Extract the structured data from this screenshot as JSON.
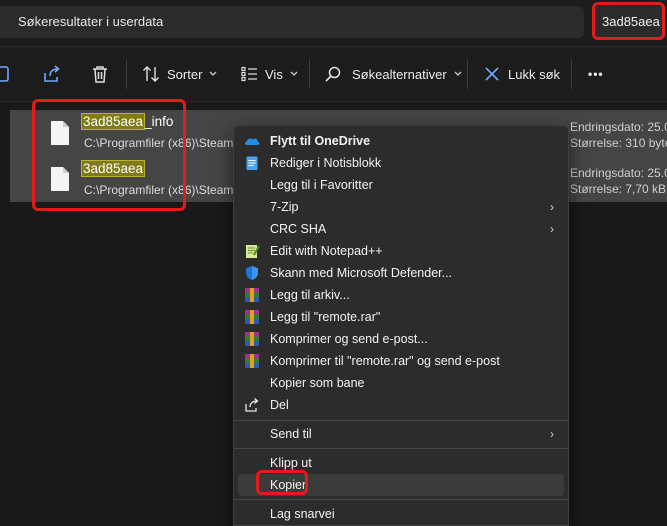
{
  "address": {
    "text": "Søkeresultater i userdata"
  },
  "search": {
    "value": "3ad85aea"
  },
  "toolbar": {
    "sort_label": "Sorter",
    "view_label": "Vis",
    "search_options_label": "Søkealternativer",
    "close_search_label": "Lukk søk",
    "more_label": "•••"
  },
  "files": [
    {
      "name_highlight": "3ad85aea",
      "name_rest": "_info",
      "path": "C:\\Programfiler (x86)\\Steam\\",
      "date": "Endringsdato: 25.0",
      "size": "Størrelse: 310 byte"
    },
    {
      "name_highlight": "3ad85aea",
      "name_rest": "",
      "path": "C:\\Programfiler (x86)\\Steam\\",
      "date": "Endringsdato: 25.0",
      "size": "Størrelse: 7,70 kB"
    }
  ],
  "menu": {
    "items": [
      {
        "label": "Flytt til OneDrive",
        "icon": "onedrive-icon"
      },
      {
        "label": "Rediger i Notisblokk",
        "icon": "notepad-icon"
      },
      {
        "label": "Legg til i Favoritter",
        "icon": ""
      },
      {
        "label": "7-Zip",
        "icon": "",
        "submenu": "›"
      },
      {
        "label": "CRC SHA",
        "icon": "",
        "submenu": "›"
      },
      {
        "label": "Edit with Notepad++",
        "icon": "notepadpp-icon"
      },
      {
        "label": "Skann med Microsoft Defender...",
        "icon": "defender-shield-icon"
      },
      {
        "label": "Legg til arkiv...",
        "icon": "winrar-icon"
      },
      {
        "label": "Legg til \"remote.rar\"",
        "icon": "winrar-icon"
      },
      {
        "label": "Komprimer og send e-post...",
        "icon": "winrar-icon"
      },
      {
        "label": "Komprimer til \"remote.rar\" og send e-post",
        "icon": "winrar-icon"
      },
      {
        "label": "Kopier som bane",
        "icon": ""
      },
      {
        "label": "Del",
        "icon": "share-icon"
      },
      {
        "label": "Send til",
        "icon": "",
        "submenu": "›"
      },
      {
        "label": "Klipp ut",
        "icon": ""
      },
      {
        "label": "Kopier",
        "icon": ""
      },
      {
        "label": "Lag snarvei",
        "icon": ""
      }
    ]
  },
  "colors": {
    "highlight_red": "#e31b1b",
    "search_match": "#7f7a1a",
    "menu_bg": "#2c2c2c",
    "selected_row": "#454545"
  }
}
